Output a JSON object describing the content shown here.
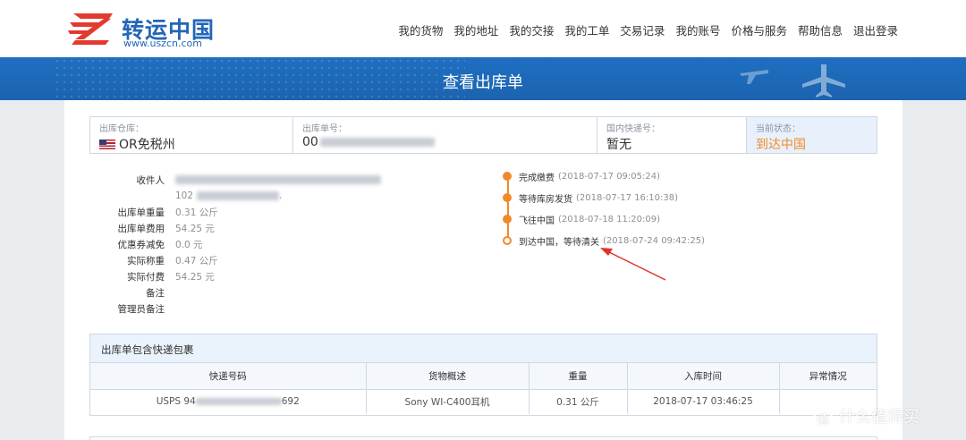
{
  "header": {
    "logo_text": "转运中国",
    "logo_url": "www.uszcn.com",
    "nav": [
      "我的货物",
      "我的地址",
      "我的交接",
      "我的工单",
      "交易记录",
      "我的账号",
      "价格与服务",
      "帮助信息",
      "退出登录"
    ]
  },
  "banner": {
    "title": "查看出库单"
  },
  "info": {
    "warehouse_label": "出库仓库：",
    "warehouse_value": "OR免税州",
    "order_label": "出库单号：",
    "order_value": "00",
    "domestic_label": "国内快递号：",
    "domestic_value": "暂无",
    "status_label": "当前状态：",
    "status_value": "到达中国"
  },
  "details": {
    "recipient_label": "收件人",
    "recipient_value_tail": "102",
    "weight_label": "出库单重量",
    "weight_value": "0.31 公斤",
    "fee_label": "出库单费用",
    "fee_value": "54.25 元",
    "coupon_label": "优惠券减免",
    "coupon_value": "0.0 元",
    "actual_weight_label": "实际称重",
    "actual_weight_value": "0.47 公斤",
    "actual_paid_label": "实际付费",
    "actual_paid_value": "54.25 元",
    "note_label": "备注",
    "admin_note_label": "管理员备注"
  },
  "timeline": [
    {
      "status": "完成缴费",
      "time": "(2018-07-17 09:05:24)"
    },
    {
      "status": "等待库房发货",
      "time": "(2018-07-17 16:10:38)"
    },
    {
      "status": "飞往中国",
      "time": "(2018-07-18 11:20:09)"
    },
    {
      "status": "到达中国，等待清关",
      "time": "(2018-07-24 09:42:25)"
    }
  ],
  "packages": {
    "title": "出库单包含快递包裹",
    "headers": [
      "快递号码",
      "货物概述",
      "重量",
      "入库时间",
      "异常情况"
    ],
    "row": {
      "tracking_prefix": "USPS 94",
      "tracking_suffix": "692",
      "desc": "Sony WI-C400耳机",
      "weight": "0.31 公斤",
      "time": "2018-07-17 03:46:25",
      "exception": ""
    }
  },
  "watermark": {
    "icon": "值",
    "text": "什么值得买"
  },
  "colors": {
    "brand_blue": "#1f6fc1",
    "accent_orange": "#f08a28",
    "arrow_red": "#e0322b"
  }
}
